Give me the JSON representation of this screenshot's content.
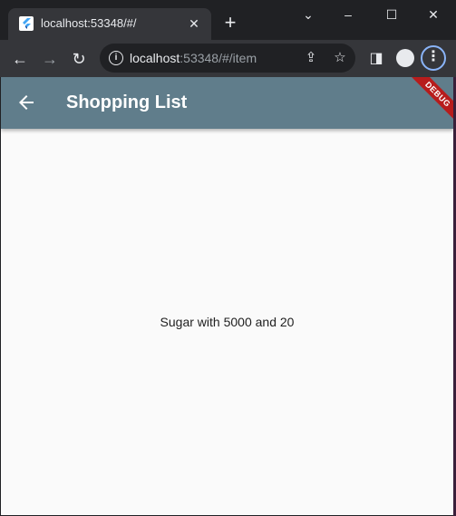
{
  "browser": {
    "tab": {
      "title": "localhost:53348/#/"
    },
    "address": {
      "host": "localhost",
      "rest": ":53348/#/item"
    }
  },
  "app": {
    "appbar": {
      "title": "Shopping List",
      "debug_label": "DEBUG"
    },
    "content": {
      "text": "Sugar with 5000 and 20"
    }
  },
  "colors": {
    "appbar": "#607d8b",
    "background": "#fafafa",
    "debug_banner": "#b71c1c",
    "browser_frame": "#202124",
    "browser_toolbar": "#35363a"
  }
}
